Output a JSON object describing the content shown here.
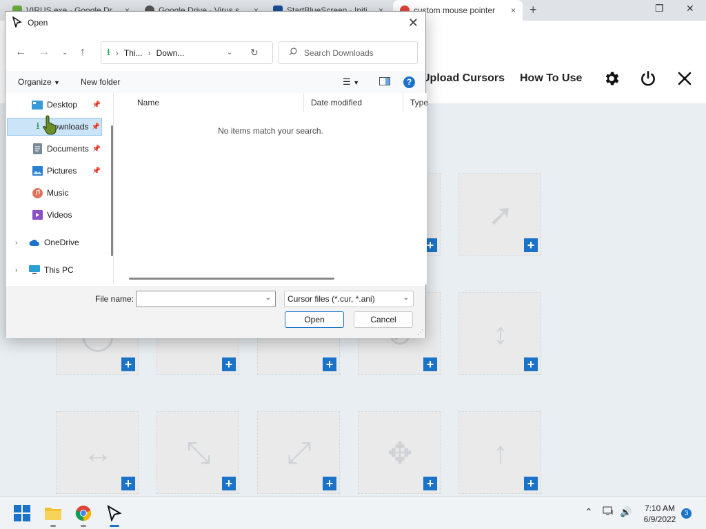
{
  "browser": {
    "tabs": [
      {
        "title": "VIRUS.exe - Google Dr",
        "fav_color": "#6cae3f"
      },
      {
        "title": "Google Drive - Virus s",
        "fav_color": "#555555"
      },
      {
        "title": "StartBlueScreen - Initi",
        "fav_color": "#1a4f9a"
      },
      {
        "title": "custom mouse pointer",
        "fav_color": "#e0453a"
      }
    ],
    "new_tab": "+",
    "close_glyph": "×"
  },
  "app": {
    "nav": {
      "upload": "Upload Cursors",
      "howto": "How To Use"
    },
    "tile_plus": "+"
  },
  "dialog": {
    "title": "Open",
    "close": "✕",
    "breadcrumb": [
      "Thi...",
      "Down..."
    ],
    "search_placeholder": "Search Downloads",
    "toolbar": {
      "organize": "Organize",
      "new_folder": "New folder",
      "help": "?"
    },
    "nav_items": [
      {
        "label": "Desktop"
      },
      {
        "label": "Downloads"
      },
      {
        "label": "Documents"
      },
      {
        "label": "Pictures"
      },
      {
        "label": "Music"
      },
      {
        "label": "Videos"
      },
      {
        "label": "OneDrive"
      },
      {
        "label": "This PC"
      }
    ],
    "columns": {
      "name": "Name",
      "date": "Date modified",
      "type": "Type"
    },
    "empty_message": "No items match your search.",
    "file_name_label": "File name:",
    "file_name_value": "",
    "file_filter": "Cursor files (*.cur, *.ani)",
    "open_button": "Open",
    "cancel_button": "Cancel"
  },
  "taskbar": {
    "time": "7:10 AM",
    "date": "6/9/2022",
    "notifications": "3"
  },
  "colors": {
    "accent": "#1a73c8",
    "selection": "#cce4f7"
  }
}
